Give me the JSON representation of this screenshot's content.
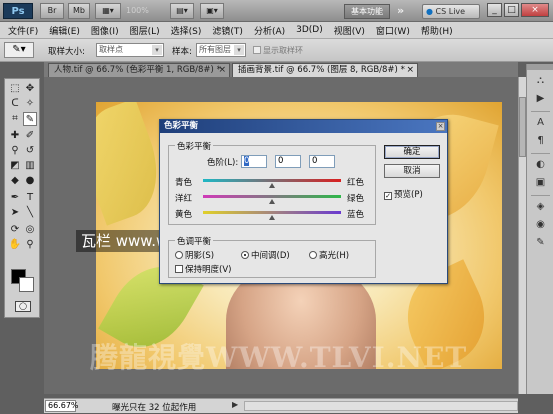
{
  "titlebar": {
    "logo": "Ps",
    "zoom": "100%",
    "workspace": "基本功能",
    "more": "»",
    "cslive": "CS Live",
    "min": "_",
    "max": "□",
    "close": "×"
  },
  "menu": [
    "文件(F)",
    "编辑(E)",
    "图像(I)",
    "图层(L)",
    "选择(S)",
    "滤镜(T)",
    "分析(A)",
    "3D(D)",
    "视图(V)",
    "窗口(W)",
    "帮助(H)"
  ],
  "options": {
    "tool_icon": "✎",
    "sample_size_label": "取样大小:",
    "sample_size_value": "取样点",
    "sample_label": "样本:",
    "sample_value": "所有图层",
    "show_ring_label": "显示取样环"
  },
  "tabs": [
    {
      "label": "人物.tif @ 66.7% (色彩平衡 1, RGB/8#) *",
      "active": false
    },
    {
      "label": "插画背景.tif @ 66.7% (图层 8, RGB/8#) *",
      "active": true
    }
  ],
  "canvas": {
    "site_watermark": "瓦栏 www.walanwalan.com",
    "bottom_watermark": "腾龍視覺WWW.TLVI.NET"
  },
  "status": {
    "zoom": "66.67%",
    "info": "曝光只在 32 位起作用",
    "arrow": "▶"
  },
  "dialog": {
    "title": "色彩平衡",
    "close": "×",
    "balance_group": "色彩平衡",
    "levels_label": "色阶(L):",
    "levels": [
      "0",
      "0",
      "0"
    ],
    "sliders": [
      {
        "left": "青色",
        "right": "红色",
        "value": 0
      },
      {
        "left": "洋红",
        "right": "绿色",
        "value": 0
      },
      {
        "left": "黄色",
        "right": "蓝色",
        "value": 0
      }
    ],
    "tone_group": "色调平衡",
    "tones": [
      {
        "label": "阴影(S)",
        "selected": false
      },
      {
        "label": "中间调(D)",
        "selected": true
      },
      {
        "label": "高光(H)",
        "selected": false
      }
    ],
    "preserve_label": "保持明度(V)",
    "preserve_checked": false,
    "ok": "确定",
    "cancel": "取消",
    "preview_label": "预览(P)",
    "preview_checked": true
  }
}
